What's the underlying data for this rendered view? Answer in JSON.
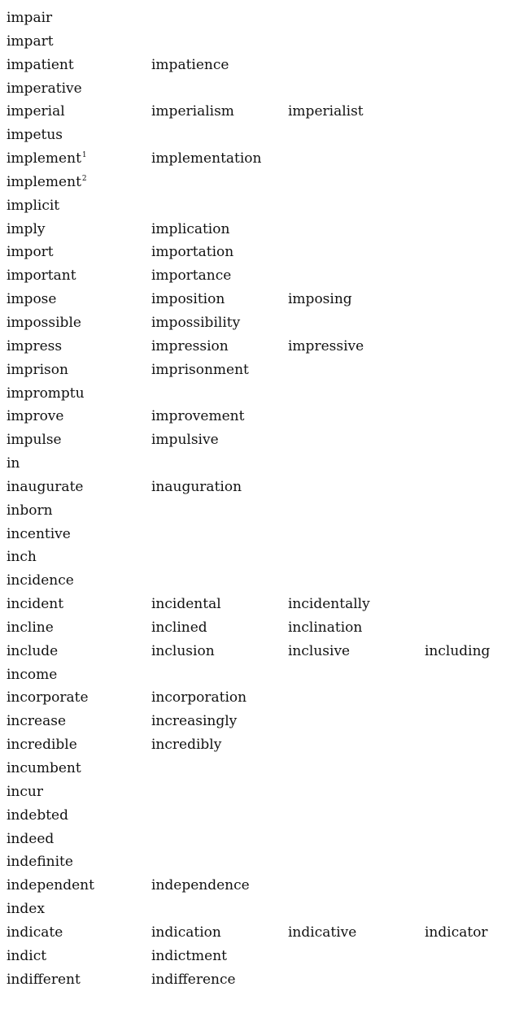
{
  "rows": [
    {
      "words": [
        {
          "text": "impair"
        }
      ]
    },
    {
      "words": [
        {
          "text": "impart"
        }
      ]
    },
    {
      "words": [
        {
          "text": "impatient"
        },
        {
          "text": "impatience"
        }
      ]
    },
    {
      "words": [
        {
          "text": "imperative"
        }
      ]
    },
    {
      "words": [
        {
          "text": "imperial"
        },
        {
          "text": "imperialism"
        },
        {
          "text": "imperialist"
        }
      ]
    },
    {
      "words": [
        {
          "text": "impetus"
        }
      ]
    },
    {
      "words": [
        {
          "text": "implement",
          "sup": "1"
        },
        {
          "text": "implementation"
        }
      ]
    },
    {
      "words": [
        {
          "text": "implement",
          "sup": "2"
        }
      ]
    },
    {
      "words": [
        {
          "text": "implicit"
        }
      ]
    },
    {
      "words": [
        {
          "text": "imply"
        },
        {
          "text": "implication"
        }
      ]
    },
    {
      "words": [
        {
          "text": "import"
        },
        {
          "text": "importation"
        }
      ]
    },
    {
      "words": [
        {
          "text": "important"
        },
        {
          "text": "importance"
        }
      ]
    },
    {
      "words": [
        {
          "text": "impose"
        },
        {
          "text": "imposition"
        },
        {
          "text": "imposing"
        }
      ]
    },
    {
      "words": [
        {
          "text": "impossible"
        },
        {
          "text": "impossibility"
        }
      ]
    },
    {
      "words": [
        {
          "text": "impress"
        },
        {
          "text": "impression"
        },
        {
          "text": "impressive"
        }
      ]
    },
    {
      "words": [
        {
          "text": "imprison"
        },
        {
          "text": "imprisonment"
        }
      ]
    },
    {
      "words": [
        {
          "text": "impromptu"
        }
      ]
    },
    {
      "words": [
        {
          "text": "improve"
        },
        {
          "text": "improvement"
        }
      ]
    },
    {
      "words": [
        {
          "text": "impulse"
        },
        {
          "text": "impulsive"
        }
      ]
    },
    {
      "words": [
        {
          "text": "in"
        }
      ]
    },
    {
      "words": [
        {
          "text": "inaugurate"
        },
        {
          "text": "inauguration"
        }
      ]
    },
    {
      "words": [
        {
          "text": "inborn"
        }
      ]
    },
    {
      "words": [
        {
          "text": "incentive"
        }
      ]
    },
    {
      "words": [
        {
          "text": "inch"
        }
      ]
    },
    {
      "words": [
        {
          "text": "incidence"
        }
      ]
    },
    {
      "words": [
        {
          "text": "incident"
        },
        {
          "text": "incidental"
        },
        {
          "text": "incidentally"
        }
      ]
    },
    {
      "words": [
        {
          "text": "incline"
        },
        {
          "text": "inclined"
        },
        {
          "text": "inclination"
        }
      ]
    },
    {
      "words": [
        {
          "text": "include"
        },
        {
          "text": "inclusion"
        },
        {
          "text": "inclusive"
        },
        {
          "text": "including"
        }
      ]
    },
    {
      "words": [
        {
          "text": "income"
        }
      ]
    },
    {
      "words": [
        {
          "text": "incorporate"
        },
        {
          "text": "incorporation"
        }
      ]
    },
    {
      "words": [
        {
          "text": "increase"
        },
        {
          "text": "increasingly"
        }
      ]
    },
    {
      "words": [
        {
          "text": "incredible"
        },
        {
          "text": "incredibly"
        }
      ]
    },
    {
      "words": [
        {
          "text": "incumbent"
        }
      ]
    },
    {
      "words": [
        {
          "text": "incur"
        }
      ]
    },
    {
      "words": [
        {
          "text": "indebted"
        }
      ]
    },
    {
      "words": [
        {
          "text": "indeed"
        }
      ]
    },
    {
      "words": [
        {
          "text": "indefinite"
        }
      ]
    },
    {
      "words": [
        {
          "text": "independent"
        },
        {
          "text": "independence"
        }
      ]
    },
    {
      "words": [
        {
          "text": "index"
        }
      ]
    },
    {
      "words": [
        {
          "text": "indicate"
        },
        {
          "text": "indication"
        },
        {
          "text": "indicative"
        },
        {
          "text": "indicator"
        }
      ]
    },
    {
      "words": [
        {
          "text": "indict"
        },
        {
          "text": "indictment"
        }
      ]
    },
    {
      "words": [
        {
          "text": "indifferent"
        },
        {
          "text": "indifference"
        }
      ]
    }
  ]
}
